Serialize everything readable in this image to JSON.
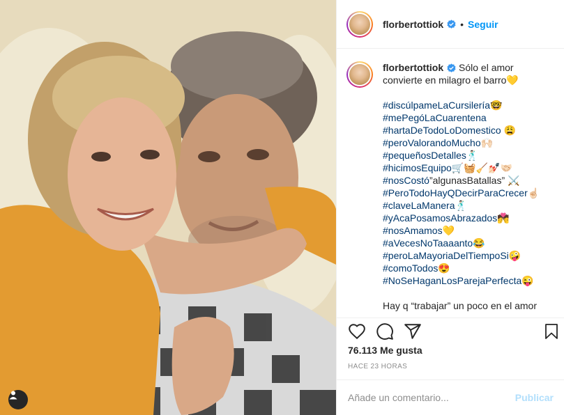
{
  "post": {
    "username": "florbertottiok",
    "follow_label": "Seguir",
    "more_label": "···",
    "separator": "•",
    "caption": {
      "text": "Sólo el amor convierte en milagro el barro💛",
      "hashtags": [
        {
          "tag": "#discúlpameLaCursilería",
          "emoji": "🤓"
        },
        {
          "tag": "#mePegóLaCuarentena",
          "emoji": ""
        },
        {
          "tag": "#hartaDeTodoLoDomestico",
          "emoji": " 😩"
        },
        {
          "tag": "#peroValorandoMucho",
          "emoji": "🙌🏻"
        },
        {
          "tag": "#pequeñosDetalles",
          "emoji": "🕺🏻"
        },
        {
          "tag": "#hicimosEquipo",
          "emoji": "🛒🧺🧹💅🏻🤝🏻"
        },
        {
          "tag": "#nosCostó",
          "emoji": "”algunasBatallas” ⚔️"
        },
        {
          "tag": "#PeroTodoHayQDecirParaCrecer",
          "emoji": "☝🏻"
        },
        {
          "tag": "#claveLaManera",
          "emoji": "🕺🏻"
        },
        {
          "tag": "#yAcaPosamosAbrazados",
          "emoji": "💏"
        },
        {
          "tag": "#nosAmamos",
          "emoji": "💛"
        },
        {
          "tag": "#aVecesNoTaaaanto",
          "emoji": "😂"
        },
        {
          "tag": "#peroLaMayoriaDelTiempoSi",
          "emoji": "🤪"
        },
        {
          "tag": "#comoTodos",
          "emoji": "😍"
        },
        {
          "tag": "#NoSeHaganLosParejaPerfecta",
          "emoji": "😜"
        }
      ],
      "tail": "Hay q “trabajar” un poco en el amor"
    },
    "likes": "76.113 Me gusta",
    "time": "HACE 23 HORAS",
    "comment": {
      "placeholder": "Añade un comentario...",
      "value": "",
      "publish_label": "Publicar"
    },
    "icons": {
      "like": "heart-icon",
      "comment": "comment-icon",
      "share": "share-icon",
      "save": "bookmark-icon",
      "user_tag": "user-tag-icon",
      "verified": "verified-badge-icon"
    },
    "colors": {
      "link_blue": "#0095f6",
      "hashtag": "#00376b",
      "muted": "#8e8e8e",
      "publish_disabled": "#b2dffc"
    }
  }
}
